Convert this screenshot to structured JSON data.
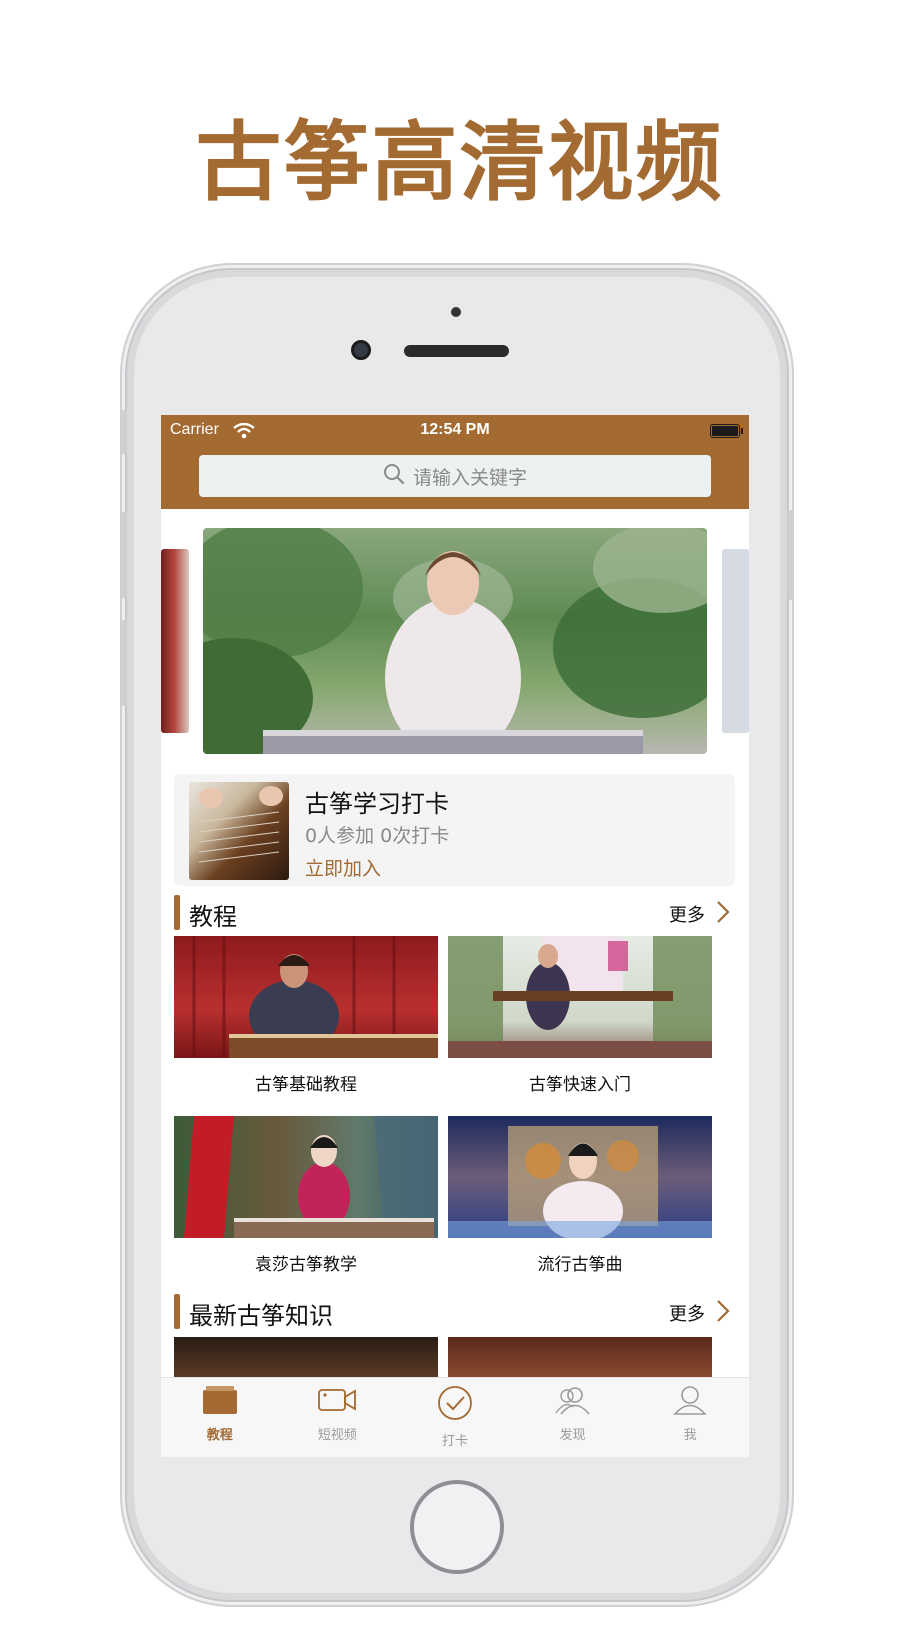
{
  "headline": "古筝高清视频",
  "status_bar": {
    "carrier": "Carrier",
    "time": "12:54 PM"
  },
  "search": {
    "placeholder": "请输入关键字"
  },
  "checkin": {
    "title": "古筝学习打卡",
    "stats": "0人参加 0次打卡",
    "join_label": "立即加入"
  },
  "tutorials_section": {
    "title": "教程",
    "more_label": "更多",
    "items": [
      {
        "label": "古筝基础教程"
      },
      {
        "label": "古筝快速入门"
      },
      {
        "label": "袁莎古筝教学"
      },
      {
        "label": "流行古筝曲"
      }
    ]
  },
  "knowledge_section": {
    "title": "最新古筝知识",
    "more_label": "更多"
  },
  "tab_bar": {
    "tabs": [
      {
        "label": "教程",
        "icon": "book-icon",
        "active": true
      },
      {
        "label": "短视频",
        "icon": "video-camera-icon",
        "active": false
      },
      {
        "label": "打卡",
        "icon": "check-circle-icon",
        "active": false
      },
      {
        "label": "发现",
        "icon": "people-icon",
        "active": false
      },
      {
        "label": "我",
        "icon": "person-icon",
        "active": false
      }
    ]
  },
  "colors": {
    "accent": "#a36a31",
    "background": "#ffffff",
    "card": "#f4f4f4"
  }
}
